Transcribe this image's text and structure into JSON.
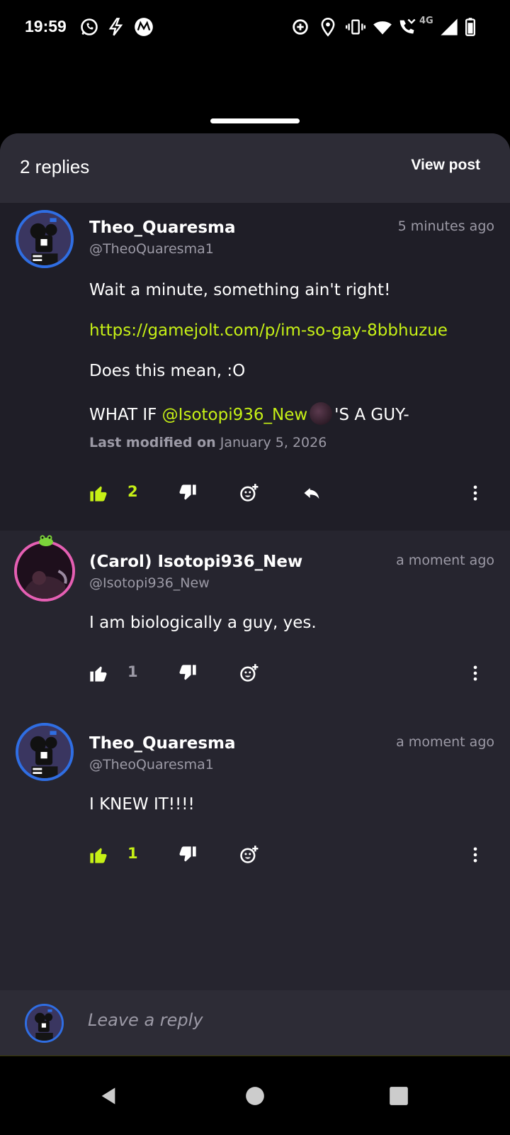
{
  "status_bar": {
    "time": "19:59",
    "network_label": "4G",
    "left_icons": [
      "whatsapp-icon",
      "flash-icon",
      "motorola-icon"
    ],
    "right_icons": [
      "location-target-icon",
      "location-pin-icon",
      "vibrate-icon",
      "wifi-icon",
      "wifi-call-icon",
      "signal-icon",
      "battery-icon"
    ]
  },
  "sheet": {
    "replies_count": "2 replies",
    "view_post_label": "View post"
  },
  "comments": [
    {
      "username": "Theo_Quaresma",
      "handle": "@TheoQuaresma1",
      "timestamp": "5 minutes ago",
      "lines": {
        "line1": "Wait a minute, something ain't right!",
        "link": "https://gamejolt.com/p/im-so-gay-8bbhuzue",
        "line3": "Does this mean, :O",
        "line4_prefix": "WHAT IF ",
        "line4_mention": "@Isotopi936_New",
        "line4_suffix": "'S A GUY-"
      },
      "modified_label": "Last modified on",
      "modified_date": "January 5, 2026",
      "likes": "2",
      "liked": true
    },
    {
      "username": "(Carol) Isotopi936_New",
      "handle": "@Isotopi936_New",
      "timestamp": "a moment ago",
      "text": "I am biologically a guy, yes.",
      "likes": "1",
      "liked": false
    },
    {
      "username": "Theo_Quaresma",
      "handle": "@TheoQuaresma1",
      "timestamp": "a moment ago",
      "text": "I KNEW IT!!!!",
      "likes": "1",
      "liked": true
    }
  ],
  "reply_bar": {
    "placeholder": "Leave a reply"
  },
  "colors": {
    "accent_green": "#c6f016",
    "sheet_bg": "#26252f",
    "header_bg": "#2d2c36",
    "avatar_ring_blue": "#2f6ee3",
    "avatar_ring_pink": "#e55fb3"
  }
}
